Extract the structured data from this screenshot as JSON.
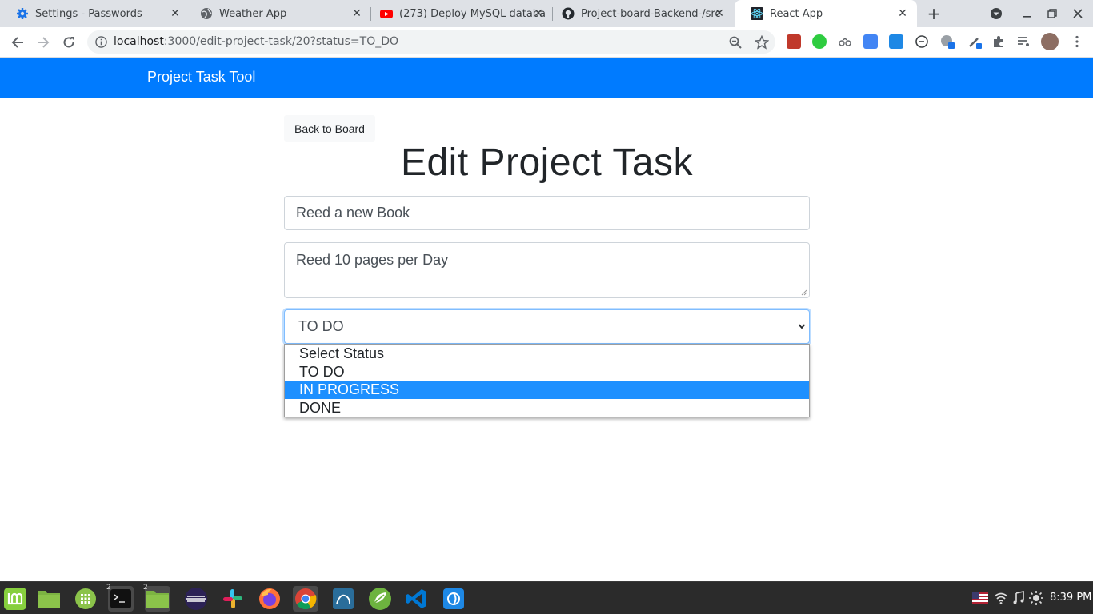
{
  "browser": {
    "tabs": [
      {
        "title": "Settings - Passwords",
        "icon": "gear-icon"
      },
      {
        "title": "Weather App",
        "icon": "globe-icon"
      },
      {
        "title": "(273) Deploy MySQL databa",
        "icon": "youtube-icon"
      },
      {
        "title": "Project-board-Backend-/src",
        "icon": "github-icon"
      },
      {
        "title": "React App",
        "icon": "react-icon"
      }
    ],
    "active_tab": 4,
    "url_host": "localhost",
    "url_rest": ":3000/edit-project-task/20?status=TO_DO"
  },
  "navbar": {
    "brand": "Project Task Tool",
    "color": "#007bff"
  },
  "page": {
    "back_button": "Back to Board",
    "title": "Edit Project Task",
    "summary_value": "Reed a new Book",
    "description_value": "Reed 10 pages per Day",
    "status_selected": "TO DO",
    "status_options": [
      "Select Status",
      "TO DO",
      "IN PROGRESS",
      "DONE"
    ],
    "highlighted_option": "IN PROGRESS"
  },
  "taskbar": {
    "apps": [
      "mint-menu-icon",
      "files-icon",
      "calculator-icon",
      "terminal-icon",
      "files-icon",
      "eclipse-icon",
      "slack-icon",
      "firefox-icon",
      "chrome-icon",
      "mysql-workbench-icon",
      "spring-tool-icon",
      "vscode-icon",
      "app-icon"
    ],
    "terminal_badge": "2",
    "files_badge": "2",
    "clock": "8:39 PM"
  }
}
